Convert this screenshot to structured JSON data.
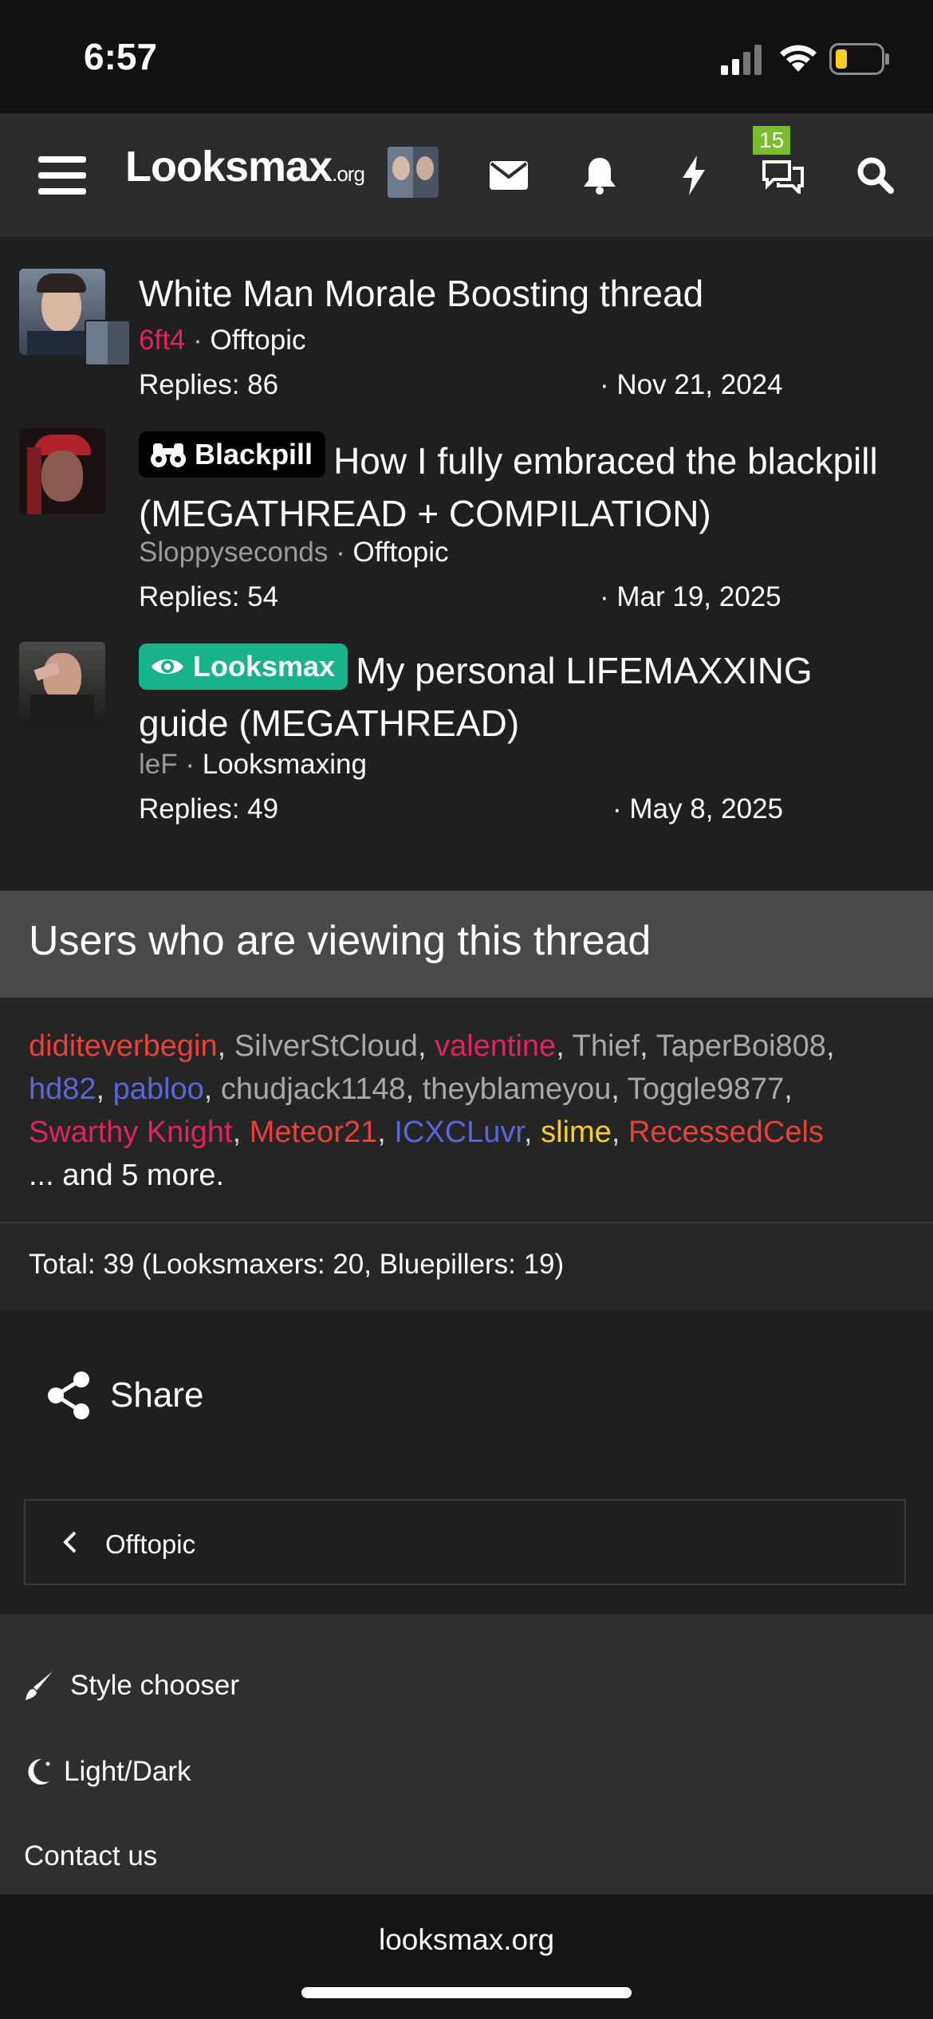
{
  "status": {
    "time": "6:57"
  },
  "nav": {
    "logo_main": "Looksmax",
    "logo_suffix": ".org",
    "chat_badge": "15"
  },
  "threads": [
    {
      "title": "White Man Morale Boosting thread",
      "author": "6ft4",
      "author_color": "#e0245e",
      "forum": "Offtopic",
      "replies": "Replies: 86",
      "date": "· Nov 21, 2024"
    },
    {
      "prefix": "Blackpill",
      "prefix_icon": "binoculars-icon",
      "title": "How I fully embraced the blackpill (MEGATHREAD + COMPILATION)",
      "author": "Sloppyseconds",
      "author_color": "#9a9a9a",
      "forum": "Offtopic",
      "replies": "Replies: 54",
      "date": "· Mar 19, 2025"
    },
    {
      "prefix": "Looksmax",
      "prefix_icon": "eye-icon",
      "prefix_color": "#19b38a",
      "title": "My personal LIFEMAXXING guide (MEGATHREAD)",
      "author": "leF",
      "author_color": "#9a9a9a",
      "forum": "Looksmaxing",
      "replies": "Replies: 49",
      "date": "· May 8, 2025"
    }
  ],
  "viewing": {
    "title": "Users who are viewing this thread",
    "users": [
      {
        "name": "diditeverbegin",
        "color": "#e8413a"
      },
      {
        "name": "SilverStCloud",
        "color": "#a8a8a8"
      },
      {
        "name": "valentine",
        "color": "#e0245e"
      },
      {
        "name": "Thief",
        "color": "#a8a8a8"
      },
      {
        "name": "TaperBoi808",
        "color": "#a8a8a8"
      },
      {
        "name": "hd82",
        "color": "#5a67d8"
      },
      {
        "name": "pabloo",
        "color": "#5a67d8"
      },
      {
        "name": "chudjack1148",
        "color": "#a8a8a8"
      },
      {
        "name": "theyblameyou",
        "color": "#a8a8a8"
      },
      {
        "name": "Toggle9877",
        "color": "#a8a8a8"
      },
      {
        "name": "Swarthy Knight",
        "color": "#e0245e"
      },
      {
        "name": "Meteor21",
        "color": "#e8413a"
      },
      {
        "name": "ICXCLuvr",
        "color": "#5a67d8"
      },
      {
        "name": "slime",
        "color": "#f2d024"
      },
      {
        "name": "RecessedCels",
        "color": "#e8413a"
      }
    ],
    "more": "... and 5 more.",
    "total": "Total: 39 (Looksmaxers: 20, Bluepillers: 19)"
  },
  "share": {
    "label": "Share"
  },
  "breadcrumb": {
    "label": "Offtopic"
  },
  "footer": {
    "style_chooser": "Style chooser",
    "light_dark": "Light/Dark",
    "contact": "Contact us"
  },
  "domain": "looksmax.org"
}
